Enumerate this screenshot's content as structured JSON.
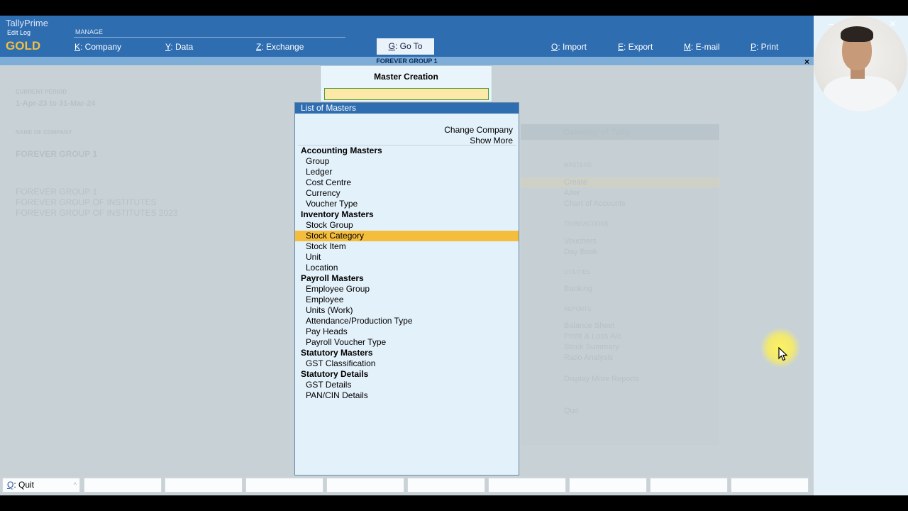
{
  "app": {
    "product": "TallyPrime",
    "edit_log": "Edit Log",
    "edition": "GOLD",
    "manage": "MANAGE"
  },
  "menu": {
    "company": {
      "key": "K",
      "label": ": Company"
    },
    "data": {
      "key": "Y",
      "label": ": Data"
    },
    "exchange": {
      "key": "Z",
      "label": ": Exchange"
    },
    "goto": {
      "key": "G",
      "label": ": Go To"
    },
    "import": {
      "key": "O",
      "label": ": Import"
    },
    "export": {
      "key": "E",
      "label": ": Export"
    },
    "email": {
      "key": "M",
      "label": ": E-mail"
    },
    "print": {
      "key": "P",
      "label": ": Print"
    }
  },
  "window_controls": {
    "minimize": "–",
    "close": "✕"
  },
  "company_bar": "FOREVER GROUP 1",
  "close_symbol": "×",
  "background": {
    "current_period_label": "CURRENT PERIOD",
    "current_period": "1-Apr-23 to 31-Mar-24",
    "name_of_company_label": "NAME OF COMPANY",
    "company_name": "FOREVER GROUP 1",
    "companies": [
      "FOREVER GROUP 1",
      "FOREVER GROUP OF INSTITUTES",
      "FOREVER GROUP OF INSTITUTES 2023"
    ],
    "gateway_title": "Gateway of Tally",
    "gateway": {
      "masters": "MASTERS",
      "create": "Create",
      "alter": "Alter",
      "chart": "Chart of Accounts",
      "transactions": "TRANSACTIONS",
      "vouchers": "Vouchers",
      "daybook": "Day Book",
      "utilities": "UTILITIES",
      "banking": "Banking",
      "reports": "REPORTS",
      "balance_sheet": "Balance Sheet",
      "pl": "Profit & Loss A/c",
      "stock_summary": "Stock Summary",
      "ratio": "Ratio Analysis",
      "display_more": "Display More Reports",
      "quit": "Quit"
    }
  },
  "master_creation": {
    "title": "Master Creation",
    "input_value": ""
  },
  "list_of_masters": {
    "title": "List of Masters",
    "change_company": "Change Company",
    "show_more": "Show More",
    "rows": [
      {
        "text": "Accounting Masters",
        "kind": "head"
      },
      {
        "text": "Group",
        "kind": "item"
      },
      {
        "text": "Ledger",
        "kind": "item"
      },
      {
        "text": "Cost Centre",
        "kind": "item"
      },
      {
        "text": "Currency",
        "kind": "item"
      },
      {
        "text": "Voucher Type",
        "kind": "item"
      },
      {
        "text": "Inventory Masters",
        "kind": "head"
      },
      {
        "text": "Stock Group",
        "kind": "item"
      },
      {
        "text": "Stock Category",
        "kind": "item",
        "selected": true
      },
      {
        "text": "Stock Item",
        "kind": "item"
      },
      {
        "text": "Unit",
        "kind": "item"
      },
      {
        "text": "Location",
        "kind": "item"
      },
      {
        "text": "Payroll Masters",
        "kind": "head"
      },
      {
        "text": "Employee Group",
        "kind": "item"
      },
      {
        "text": "Employee",
        "kind": "item"
      },
      {
        "text": "Units (Work)",
        "kind": "item"
      },
      {
        "text": "Attendance/Production Type",
        "kind": "item"
      },
      {
        "text": "Pay Heads",
        "kind": "item"
      },
      {
        "text": "Payroll Voucher Type",
        "kind": "item"
      },
      {
        "text": "Statutory Masters",
        "kind": "head"
      },
      {
        "text": "GST Classification",
        "kind": "item"
      },
      {
        "text": "Statutory Details",
        "kind": "head"
      },
      {
        "text": "GST Details",
        "kind": "item"
      },
      {
        "text": "PAN/CIN Details",
        "kind": "item"
      }
    ]
  },
  "bottom_bar": {
    "quit": {
      "key": "Q",
      "label": ": Quit"
    },
    "caret": "^"
  },
  "colors": {
    "header_blue": "#2f6db1",
    "selection": "#f5bd3c",
    "edition_gold": "#f0c040"
  }
}
